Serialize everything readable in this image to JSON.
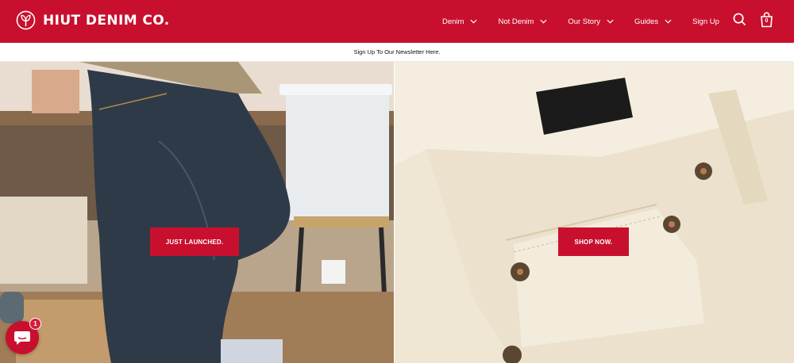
{
  "brand": {
    "name": "HIUT DENIM CO."
  },
  "nav": {
    "items": [
      {
        "label": "Denim",
        "has_dropdown": true
      },
      {
        "label": "Not Denim",
        "has_dropdown": true
      },
      {
        "label": "Our Story",
        "has_dropdown": true
      },
      {
        "label": "Guides",
        "has_dropdown": true
      },
      {
        "label": "Sign Up",
        "has_dropdown": false
      }
    ],
    "icons": [
      "search-icon",
      "shopping-bag-icon"
    ],
    "cart_count": "0"
  },
  "announcement": {
    "text": "Sign Up To Our Newsletter Here."
  },
  "hero": {
    "left": {
      "button_label": "JUST LAUNCHED."
    },
    "right": {
      "button_label": "SHOP NOW."
    }
  },
  "chat": {
    "badge_count": "1"
  },
  "colors": {
    "brand_red": "#c8102e",
    "white": "#ffffff"
  }
}
